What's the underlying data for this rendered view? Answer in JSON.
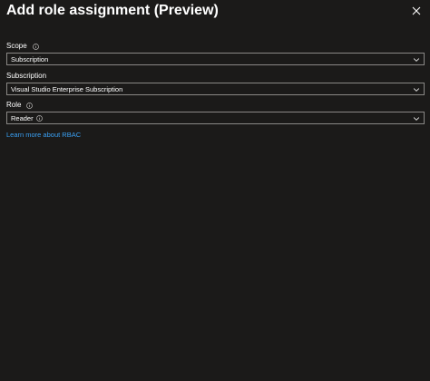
{
  "panel": {
    "title": "Add role assignment (Preview)"
  },
  "scope": {
    "label": "Scope",
    "value": "Subscription"
  },
  "subscription": {
    "label": "Subscription",
    "value": "Visual Studio Enterprise Subscription"
  },
  "role": {
    "label": "Role",
    "value": "Reader"
  },
  "links": {
    "learn_more": "Learn more about RBAC"
  },
  "colors": {
    "background": "#1b1a19",
    "border": "#8a8886",
    "link": "#3aa0f3",
    "text": "#ffffff"
  }
}
